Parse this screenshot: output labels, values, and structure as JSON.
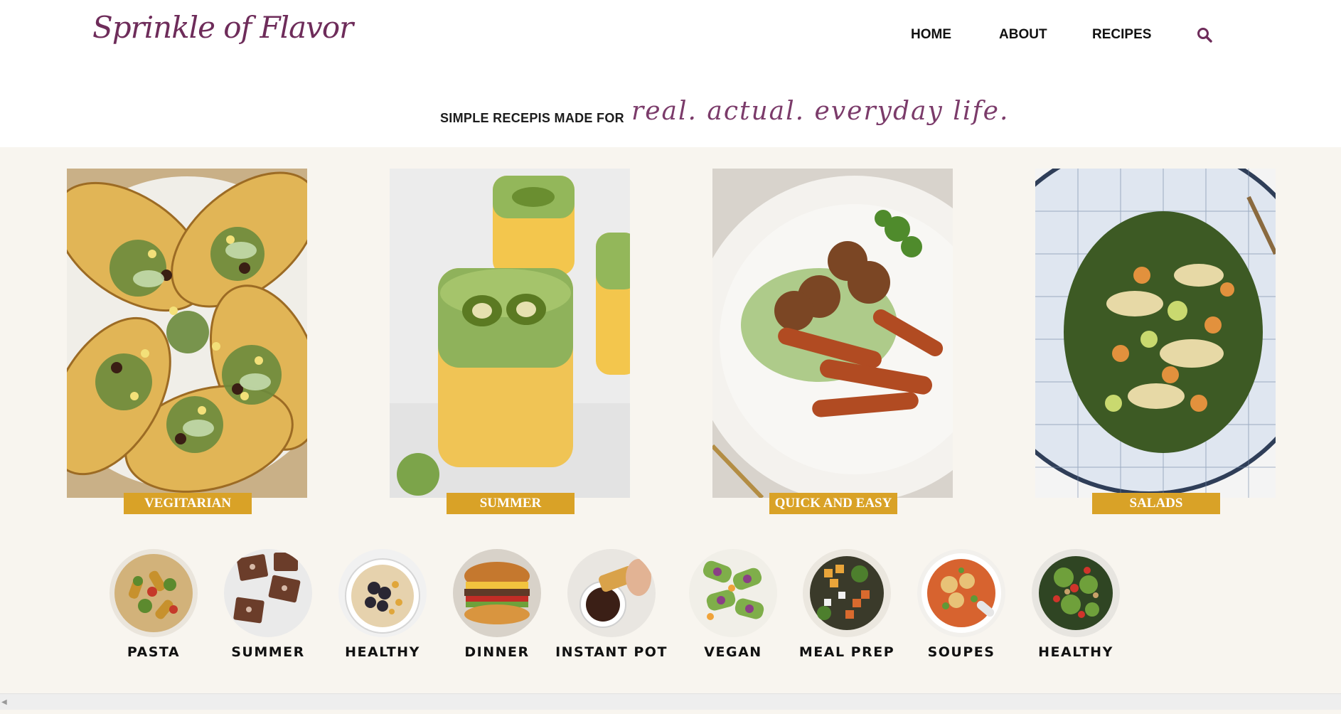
{
  "brand": {
    "logo_text": "Sprinkle of Flavor",
    "color": "#6e2c5a"
  },
  "nav": {
    "items": [
      {
        "label": "HOME"
      },
      {
        "label": "ABOUT"
      },
      {
        "label": "RECIPES"
      }
    ],
    "search_icon": "search-icon"
  },
  "tagline": {
    "plain": "SIMPLE RECEPIS MADE FOR",
    "script": "real. actual. everyday life."
  },
  "categories": [
    {
      "label": "VEGITARIAN",
      "photo": "tacos"
    },
    {
      "label": "SUMMER",
      "photo": "kiwi-smoothie"
    },
    {
      "label": "QUICK AND EASY",
      "photo": "meatballs-sweet-potato"
    },
    {
      "label": "SALADS",
      "photo": "slaw-salad"
    }
  ],
  "quick_links": [
    {
      "label": "PASTA"
    },
    {
      "label": "SUMMER"
    },
    {
      "label": "HEALTHY"
    },
    {
      "label": "DINNER"
    },
    {
      "label": "INSTANT POT"
    },
    {
      "label": "VEGAN"
    },
    {
      "label": "MEAL PREP"
    },
    {
      "label": "SOUPES"
    },
    {
      "label": "HEALTHY"
    }
  ],
  "colors": {
    "accent": "#d9a227",
    "background": "#f8f5ef"
  }
}
